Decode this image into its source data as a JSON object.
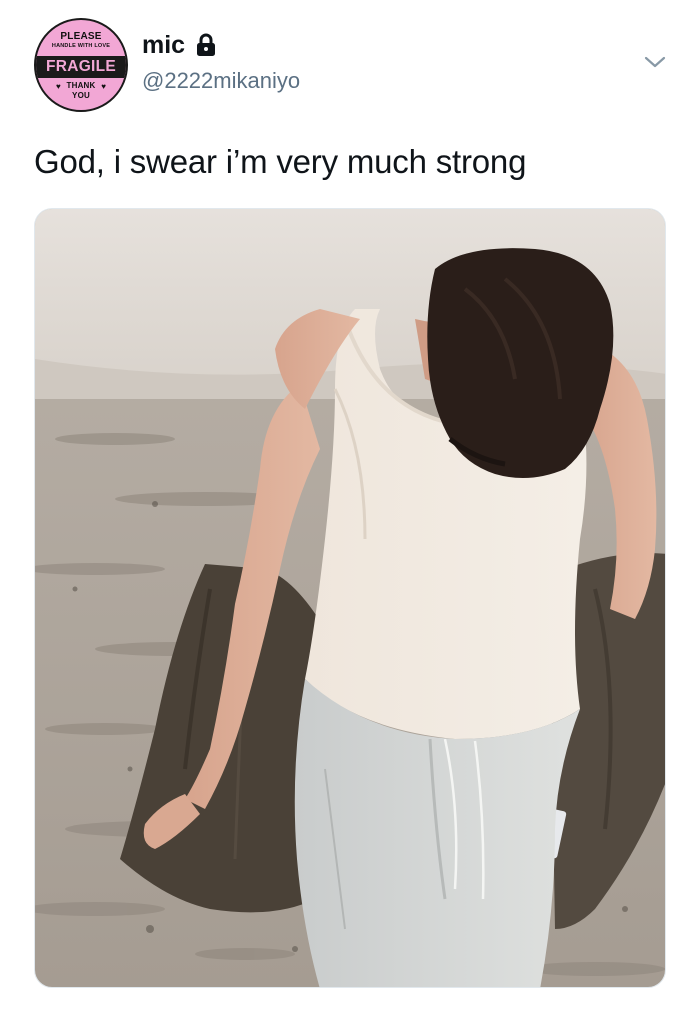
{
  "avatar": {
    "line1": "PLEASE",
    "line2": "HANDLE WITH LOVE",
    "band": "FRAGILE",
    "line3": "THANK",
    "line4": "YOU"
  },
  "user": {
    "display_name": "mic",
    "handle": "@2222mikaniyo",
    "protected_icon": "lock-icon"
  },
  "tweet": {
    "text": "God, i swear i’m very much strong"
  },
  "media": {
    "type": "photo"
  },
  "colors": {
    "avatar_pink": "#f2a7d5",
    "handle_gray": "#5b7083",
    "text": "#0f1419"
  }
}
